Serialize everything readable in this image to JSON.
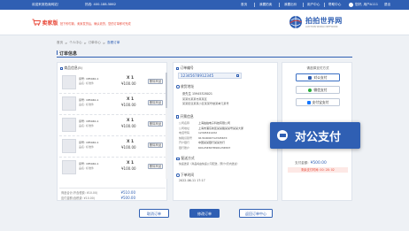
{
  "topbar": {
    "welcome": "欢迎来到拍卖网站！",
    "phone": "热线: 400-188-5862",
    "nav": [
      "首页",
      "我要拍卖",
      "我要出价",
      "用户中心",
      "帮助中心"
    ],
    "user": "您好, 用户A111",
    "logout": "退出"
  },
  "header": {
    "logo_text": "卖家版",
    "slogan": "拍下即付款，卖家发货后，确认收货，您的订单即可完成",
    "brand": "拍拍世界网",
    "brand_sub": "AUCTION WORLD NETWORK"
  },
  "breadcrumb": [
    "首页",
    "个人中心",
    "订单中心",
    "查看订单"
  ],
  "page_title": "订单信息",
  "goods": {
    "header": "商品信息(5)",
    "items": [
      {
        "line1": "货号: 185040-1",
        "line2": "品名: 标准件",
        "qty": "X 1",
        "price": "¥100.00",
        "btn": "删除商品"
      },
      {
        "line1": "货号: 185040-1",
        "line2": "品名: 标准件",
        "qty": "X 1",
        "price": "¥100.00",
        "btn": "删除商品"
      },
      {
        "line1": "货号: 185040-1",
        "line2": "品名: 标准件",
        "qty": "X 1",
        "price": "¥100.00",
        "btn": "删除商品"
      },
      {
        "line1": "货号: 185040-1",
        "line2": "品名: 标准件",
        "qty": "X 1",
        "price": "¥100.00",
        "btn": "删除商品"
      },
      {
        "line1": "货号: 185040-1",
        "line2": "品名: 标准件",
        "qty": "X 1",
        "price": "¥100.00",
        "btn": "删除商品"
      }
    ],
    "summary": [
      {
        "label": "商品合计(不含税费: ¥10.00)",
        "value": "¥510.00"
      },
      {
        "label": "应付金额(含税费: ¥10.00)",
        "value": "¥500.00"
      }
    ]
  },
  "order": {
    "order_no_label": "订单编号",
    "order_no": "12345678912345",
    "receiver_title": "收货地址",
    "receiver_name": "张先生  15945328021",
    "receiver_addr1": "某某省某某市某某区",
    "receiver_addr2": "某某街道某某小区某某号楼某单元某号",
    "invoice_title": "开票信息",
    "invoice_rows": [
      [
        "公司名称",
        "上海拍拍电子科技有限公司"
      ],
      [
        "公司地址",
        "上海市浦东新区某某路某某号某某大厦"
      ],
      [
        "电话号码",
        "12345321432"
      ],
      [
        "纳税识别号",
        "9131000071234567X"
      ],
      [
        "开户银行",
        "中国某某银行某某支行"
      ],
      [
        "银行账户",
        "6012345678901234567"
      ]
    ],
    "shipping_title": "配送方式",
    "shipping_text": "快递送货（商品将由快递公司配送，预计3天内送达）",
    "time_title": "下单时间",
    "time_text": "2022-06-11  17:17"
  },
  "pay": {
    "title": "请选择支付方式",
    "options": [
      "对公支付",
      "微信支付",
      "支付宝支付"
    ],
    "amount_label": "支付金额:",
    "amount": "¥500.00",
    "countdown": "剩余支付时间: 00: 28: 02"
  },
  "popup": {
    "label": "对公支付"
  },
  "buttons": {
    "cancel": "取消订单",
    "modify": "修改订单",
    "back": "返回订单中心"
  },
  "colors": {
    "brand_blue": "#2f5fb3",
    "accent_red": "#e84a3a",
    "wechat_green": "#2aae3a",
    "alipay_blue": "#1677ff"
  }
}
